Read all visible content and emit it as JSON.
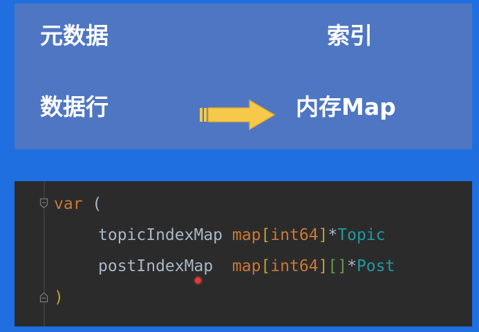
{
  "slide": {
    "metadata_label": "元数据",
    "index_label": "索引",
    "datarow_label": "数据行",
    "memory_map_label": "内存Map",
    "arrow_color": "#f6c94b"
  },
  "code": {
    "line1": {
      "keyword": "var",
      "paren": " ("
    },
    "line2": {
      "ident": "topicIndexMap",
      "map_kw": "map",
      "br_open": "[",
      "key_type": "int64",
      "br_close": "]",
      "star": "*",
      "val_type": "Topic"
    },
    "line3": {
      "ident": "postIndexMap",
      "map_kw": "map",
      "br_open": "[",
      "key_type": "int64",
      "br_close": "]",
      "slice": "[]",
      "star": "*",
      "val_type": "Post"
    },
    "line4": {
      "paren": ")"
    }
  },
  "colors": {
    "background": "#1f6fe0",
    "panel": "#4e76c3",
    "editor_bg": "#2b2b2b",
    "keyword": "#cc7832",
    "type": "#20999d"
  }
}
